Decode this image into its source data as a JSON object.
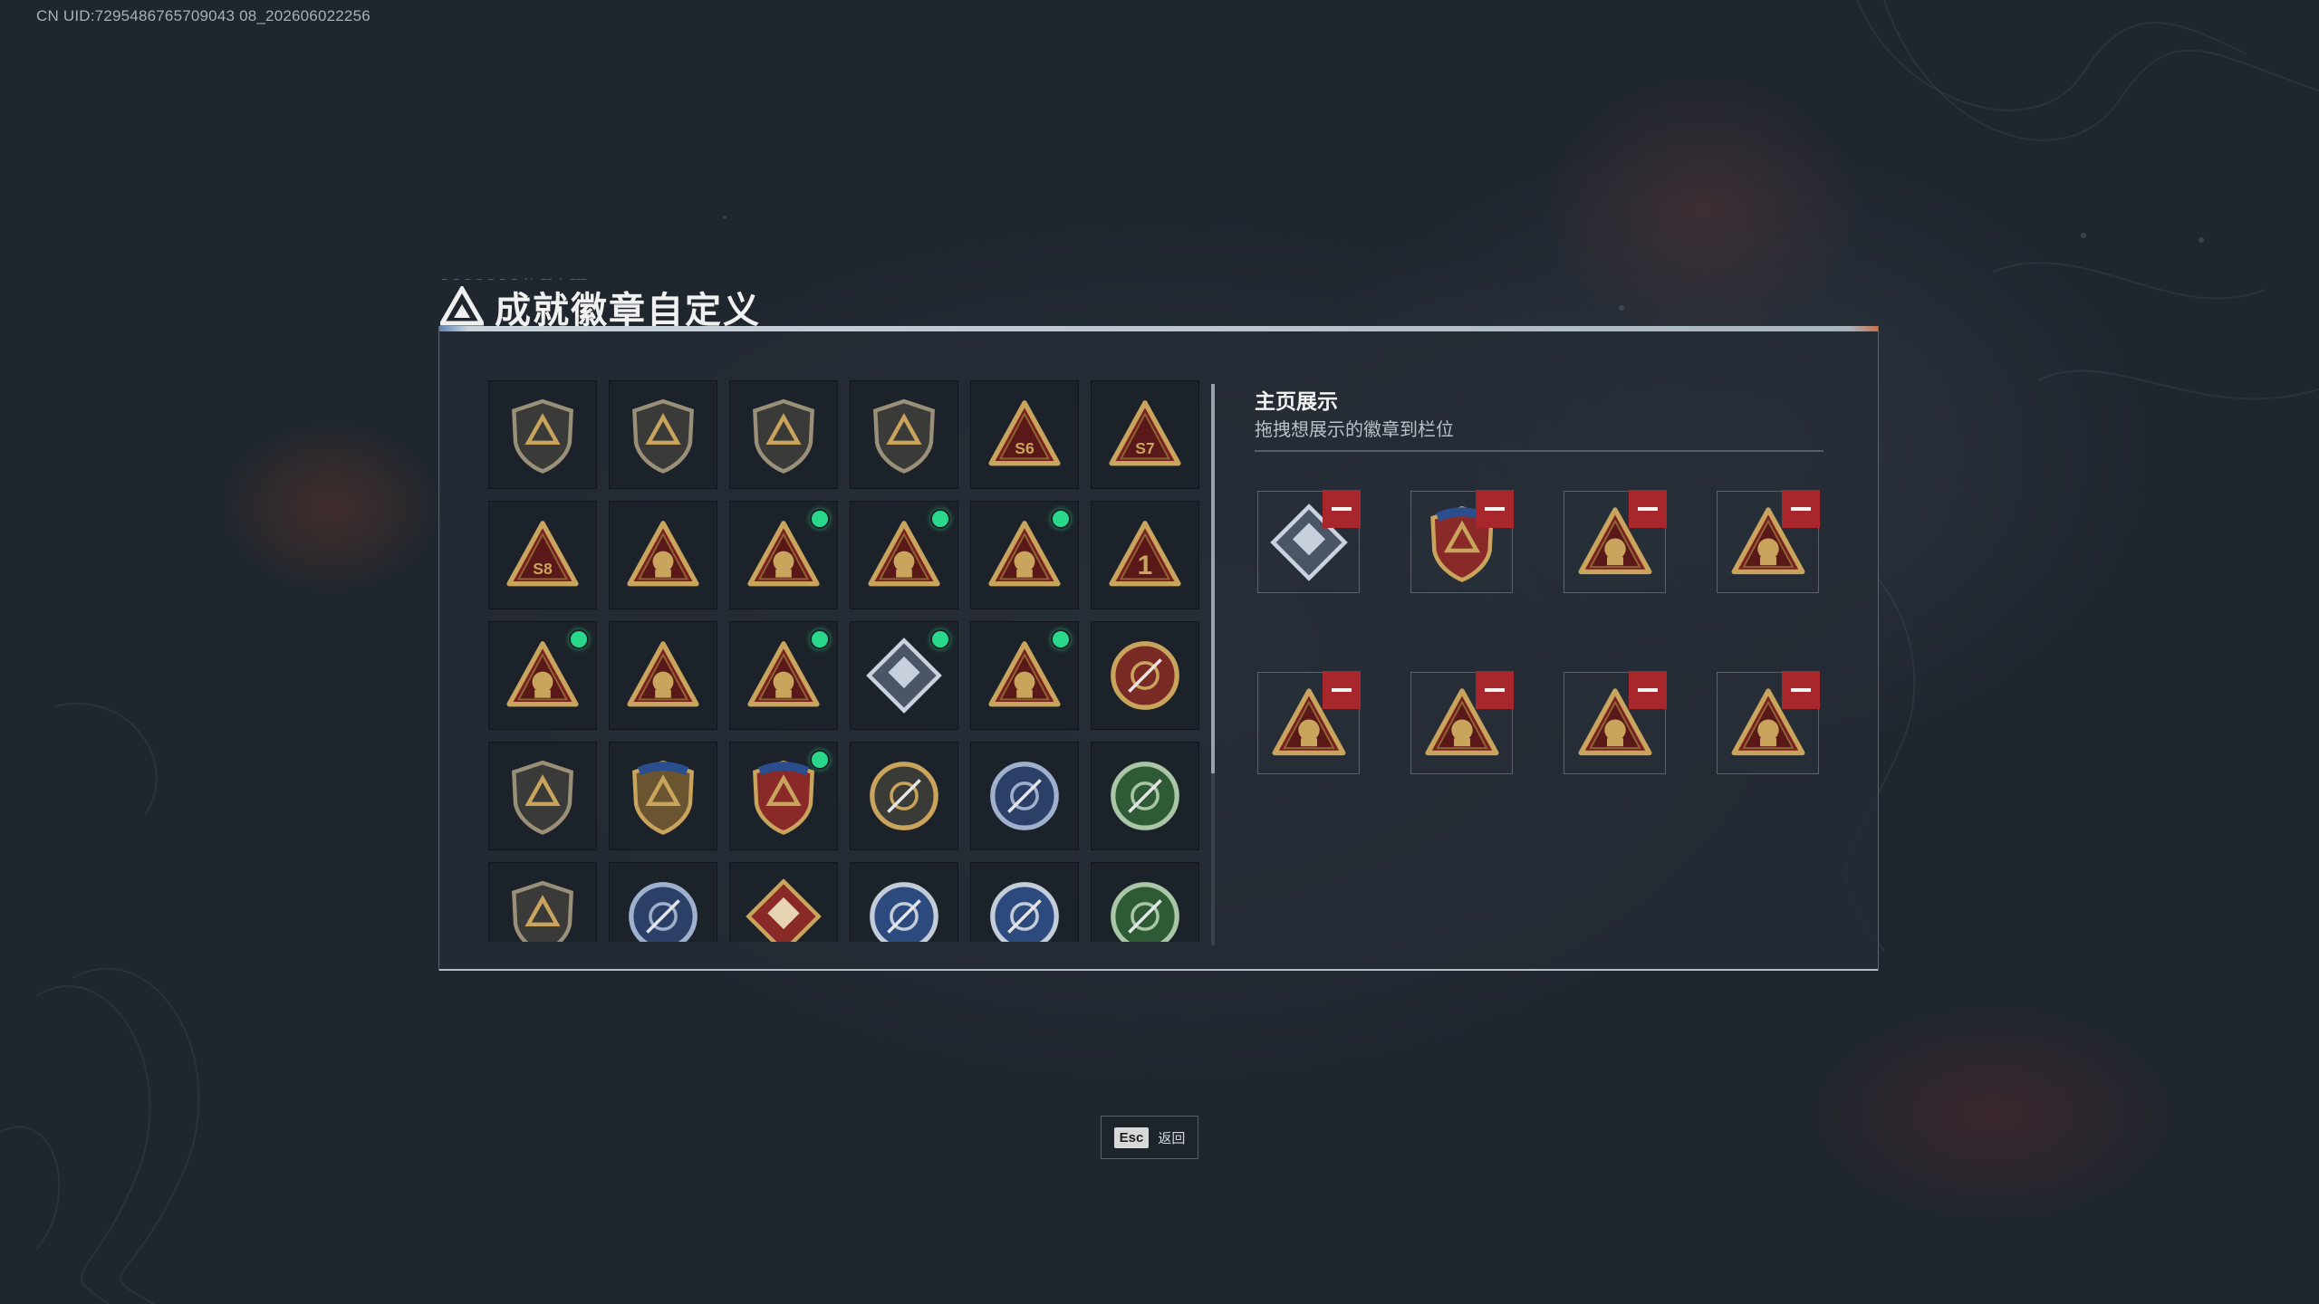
{
  "header": {
    "uid": "CN UID:7295486765709043 08_202606022256"
  },
  "window": {
    "title": "成就徽章自定义",
    "title_decoration_text": "— — — — — — — ·· —— · ———"
  },
  "badge_grid": {
    "items": [
      {
        "icon": "shield-triangle-badge",
        "new": false
      },
      {
        "icon": "shield-helicopter-badge",
        "new": false
      },
      {
        "icon": "shield-diamond-emblem-badge",
        "new": false
      },
      {
        "icon": "shield-arrow-badge",
        "new": false
      },
      {
        "icon": "triangle-badge",
        "label": "S6",
        "new": false
      },
      {
        "icon": "triangle-badge",
        "label": "S7",
        "new": false
      },
      {
        "icon": "triangle-badge",
        "label": "S8",
        "new": false
      },
      {
        "icon": "triangle-helicopter-badge",
        "new": false
      },
      {
        "icon": "triangle-operator-badge",
        "new": true
      },
      {
        "icon": "triangle-hand-sign-badge",
        "new": true
      },
      {
        "icon": "triangle-helmet-badge",
        "new": true
      },
      {
        "icon": "triangle-badge",
        "label": "1",
        "new": false
      },
      {
        "icon": "triangle-crate-badge",
        "new": true
      },
      {
        "icon": "triangle-soldier-badge",
        "new": false
      },
      {
        "icon": "triangle-rocket-badge",
        "new": true
      },
      {
        "icon": "diamond-crystal-badge",
        "new": true
      },
      {
        "icon": "triangle-blade-badge",
        "new": true
      },
      {
        "icon": "star-medal-badge",
        "new": false
      },
      {
        "icon": "shield-eagle-badge",
        "new": false
      },
      {
        "icon": "shield-gold-stars-badge",
        "new": false
      },
      {
        "icon": "shield-red-stars-badge",
        "new": true
      },
      {
        "icon": "round-pearl-badge",
        "new": false
      },
      {
        "icon": "blue-crosshair-badge",
        "new": false
      },
      {
        "icon": "green-crosshair-badge",
        "new": false
      },
      {
        "icon": "shield-rifle-badge",
        "new": false
      },
      {
        "icon": "blue-gold-wing-badge",
        "new": false
      },
      {
        "icon": "diamond-wolf-badge",
        "new": false
      },
      {
        "icon": "round-eagle-badge",
        "new": false
      },
      {
        "icon": "round-eagle-badge",
        "new": false
      },
      {
        "icon": "green-dragon-badge",
        "new": false
      }
    ]
  },
  "showcase": {
    "title": "主页展示",
    "subtitle": "拖拽想展示的徽章到栏位",
    "slots": [
      {
        "icon": "diamond-crystal-badge"
      },
      {
        "icon": "shield-red-stars-badge"
      },
      {
        "icon": "triangle-hand-sign-badge"
      },
      {
        "icon": "triangle-helmet-badge"
      },
      {
        "icon": "triangle-crate-badge"
      },
      {
        "icon": "triangle-operator-badge"
      },
      {
        "icon": "triangle-blade-badge"
      },
      {
        "icon": "triangle-rocket-badge"
      }
    ]
  },
  "footer": {
    "esc_key": "Esc",
    "back_label": "返回"
  },
  "colors": {
    "background": "#1f262e",
    "panel": "#242c34",
    "badge_gold": "#c9a45c",
    "badge_red": "#7a2020",
    "new_dot": "#2ad88b",
    "remove_button": "#a8272c"
  }
}
